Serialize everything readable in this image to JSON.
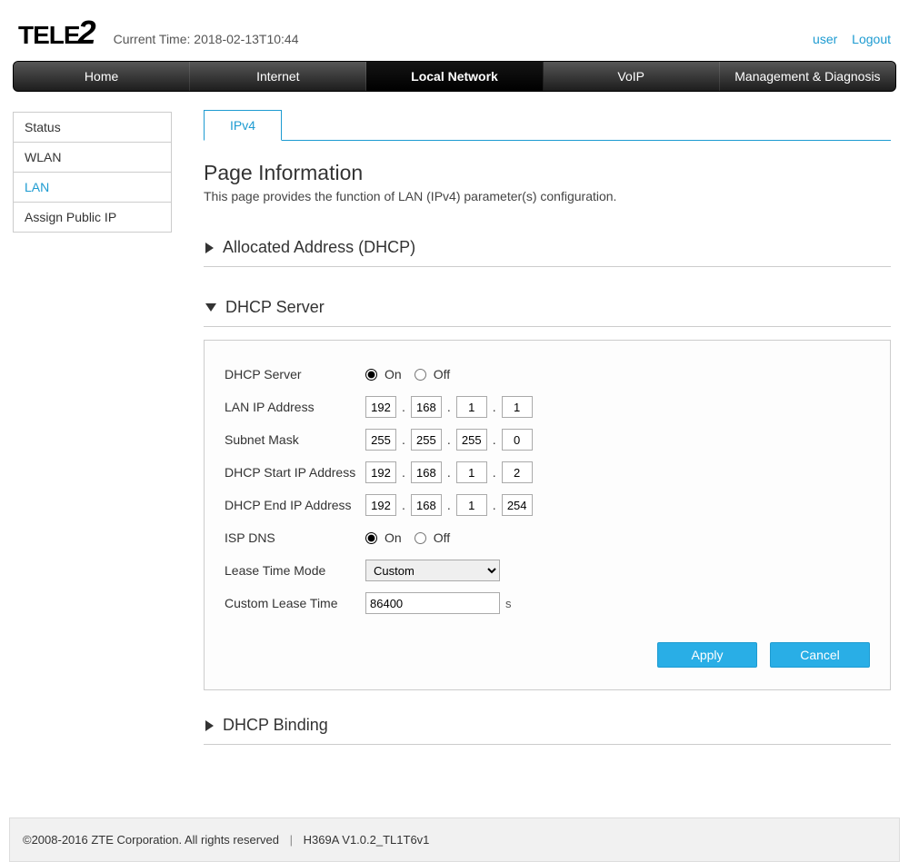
{
  "header": {
    "logo_prefix": "TELE",
    "logo_suffix": "2",
    "time_label": "Current Time:",
    "time_value": "2018-02-13T10:44",
    "user_link": "user",
    "logout_link": "Logout"
  },
  "nav": {
    "items": [
      "Home",
      "Internet",
      "Local Network",
      "VoIP",
      "Management & Diagnosis"
    ],
    "active_index": 2
  },
  "sidebar": {
    "items": [
      "Status",
      "WLAN",
      "LAN",
      "Assign Public IP"
    ],
    "active_index": 2
  },
  "tabs": {
    "items": [
      "IPv4"
    ],
    "active_index": 0
  },
  "page_info": {
    "title": "Page Information",
    "description": "This page provides the function of LAN (IPv4) parameter(s) configuration."
  },
  "sections": {
    "allocated": {
      "title": "Allocated Address (DHCP)",
      "expanded": false
    },
    "dhcp_server": {
      "title": "DHCP Server",
      "expanded": true
    },
    "dhcp_binding": {
      "title": "DHCP Binding",
      "expanded": false
    }
  },
  "form": {
    "labels": {
      "dhcp_server": "DHCP Server",
      "lan_ip": "LAN IP Address",
      "subnet": "Subnet Mask",
      "start_ip": "DHCP Start IP Address",
      "end_ip": "DHCP End IP Address",
      "isp_dns": "ISP DNS",
      "lease_mode": "Lease Time Mode",
      "custom_lease": "Custom Lease Time"
    },
    "radio": {
      "on": "On",
      "off": "Off"
    },
    "dhcp_server": "On",
    "lan_ip": [
      "192",
      "168",
      "1",
      "1"
    ],
    "subnet": [
      "255",
      "255",
      "255",
      "0"
    ],
    "start_ip": [
      "192",
      "168",
      "1",
      "2"
    ],
    "end_ip": [
      "192",
      "168",
      "1",
      "254"
    ],
    "isp_dns": "On",
    "lease_mode": "Custom",
    "lease_mode_options": [
      "Custom"
    ],
    "custom_lease": "86400",
    "custom_lease_unit": "s",
    "buttons": {
      "apply": "Apply",
      "cancel": "Cancel"
    }
  },
  "footer": {
    "copyright": "©2008-2016 ZTE Corporation. All rights reserved",
    "version": "H369A V1.0.2_TL1T6v1"
  }
}
